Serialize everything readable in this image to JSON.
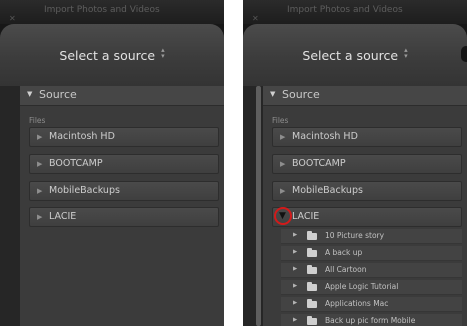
{
  "window": {
    "title": "Import Photos and Videos"
  },
  "header": {
    "source_label": "Select a source"
  },
  "panel": {
    "section_title": "Source",
    "files_label": "Files",
    "volumes": [
      "Macintosh HD",
      "BOOTCAMP",
      "MobileBackups",
      "LACIE"
    ]
  },
  "lacie_folders": [
    "10 Picture story",
    "A back up",
    "All Cartoon",
    "Apple Logic Tutorial",
    "Applications Mac",
    "Back up pic form Mobile"
  ],
  "icons": {
    "collapsed": "triangle-right-icon",
    "expanded": "triangle-down-icon",
    "folder": "folder-icon",
    "dropdown": "up-down-arrows-icon"
  },
  "colors": {
    "highlight_circle": "#d21a1a"
  }
}
